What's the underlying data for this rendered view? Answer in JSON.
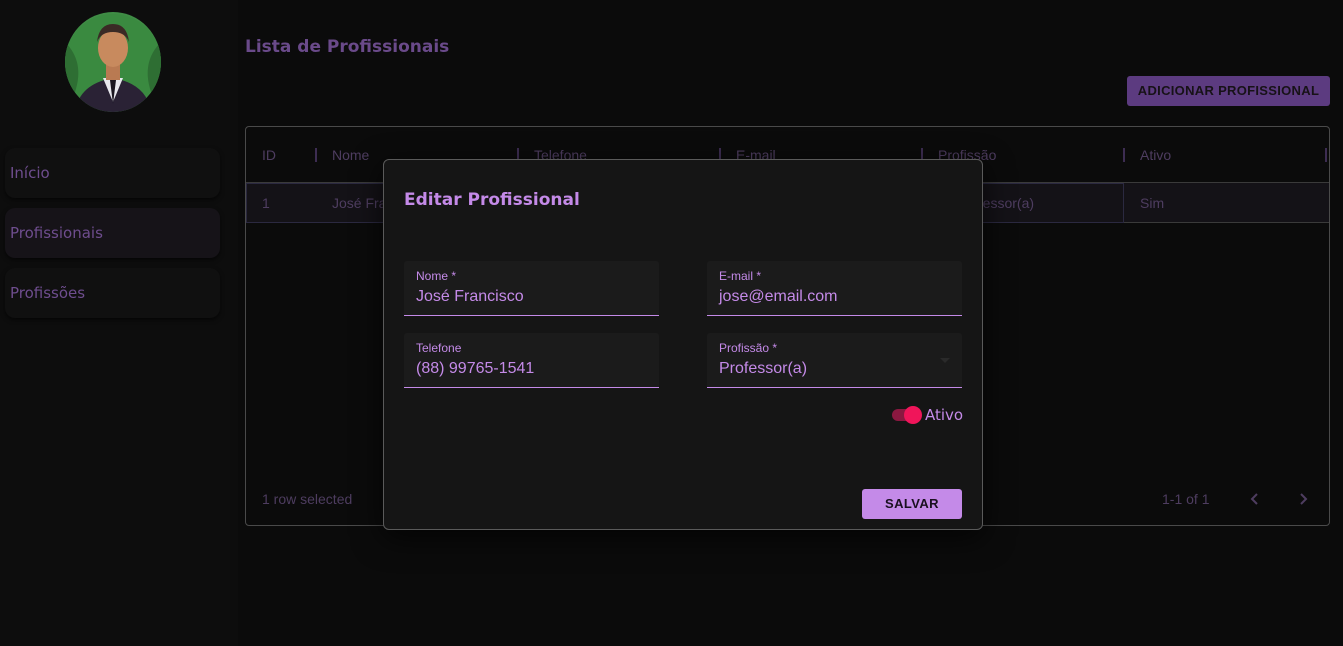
{
  "sidebar": {
    "items": [
      {
        "label": "Início"
      },
      {
        "label": "Profissionais"
      },
      {
        "label": "Profissões"
      }
    ]
  },
  "main": {
    "title": "Lista de Profissionais",
    "add_button": "ADICIONAR PROFISSIONAL",
    "table": {
      "columns": [
        "ID",
        "Nome",
        "Telefone",
        "E-mail",
        "Profissão",
        "Ativo"
      ],
      "rows": [
        {
          "id": "1",
          "nome": "José Fra",
          "profissao": "ofessor(a)",
          "ativo": "Sim"
        }
      ],
      "footer": {
        "selected": "1 row selected",
        "pagination": "1-1 of 1"
      }
    }
  },
  "dialog": {
    "title": "Editar Profissional",
    "fields": {
      "nome": {
        "label": "Nome *",
        "value": "José Francisco"
      },
      "email": {
        "label": "E-mail *",
        "value": "jose@email.com"
      },
      "telefone": {
        "label": "Telefone",
        "value": "(88) 99765-1541"
      },
      "profissao": {
        "label": "Profissão *",
        "value": "Professor(a)"
      }
    },
    "toggle": {
      "label": "Ativo",
      "checked": true
    },
    "save_button": "SALVAR"
  },
  "colors": {
    "accent": "#c48ae8",
    "toggle": "#f0155a",
    "muted_purple": "#4e3d60"
  }
}
